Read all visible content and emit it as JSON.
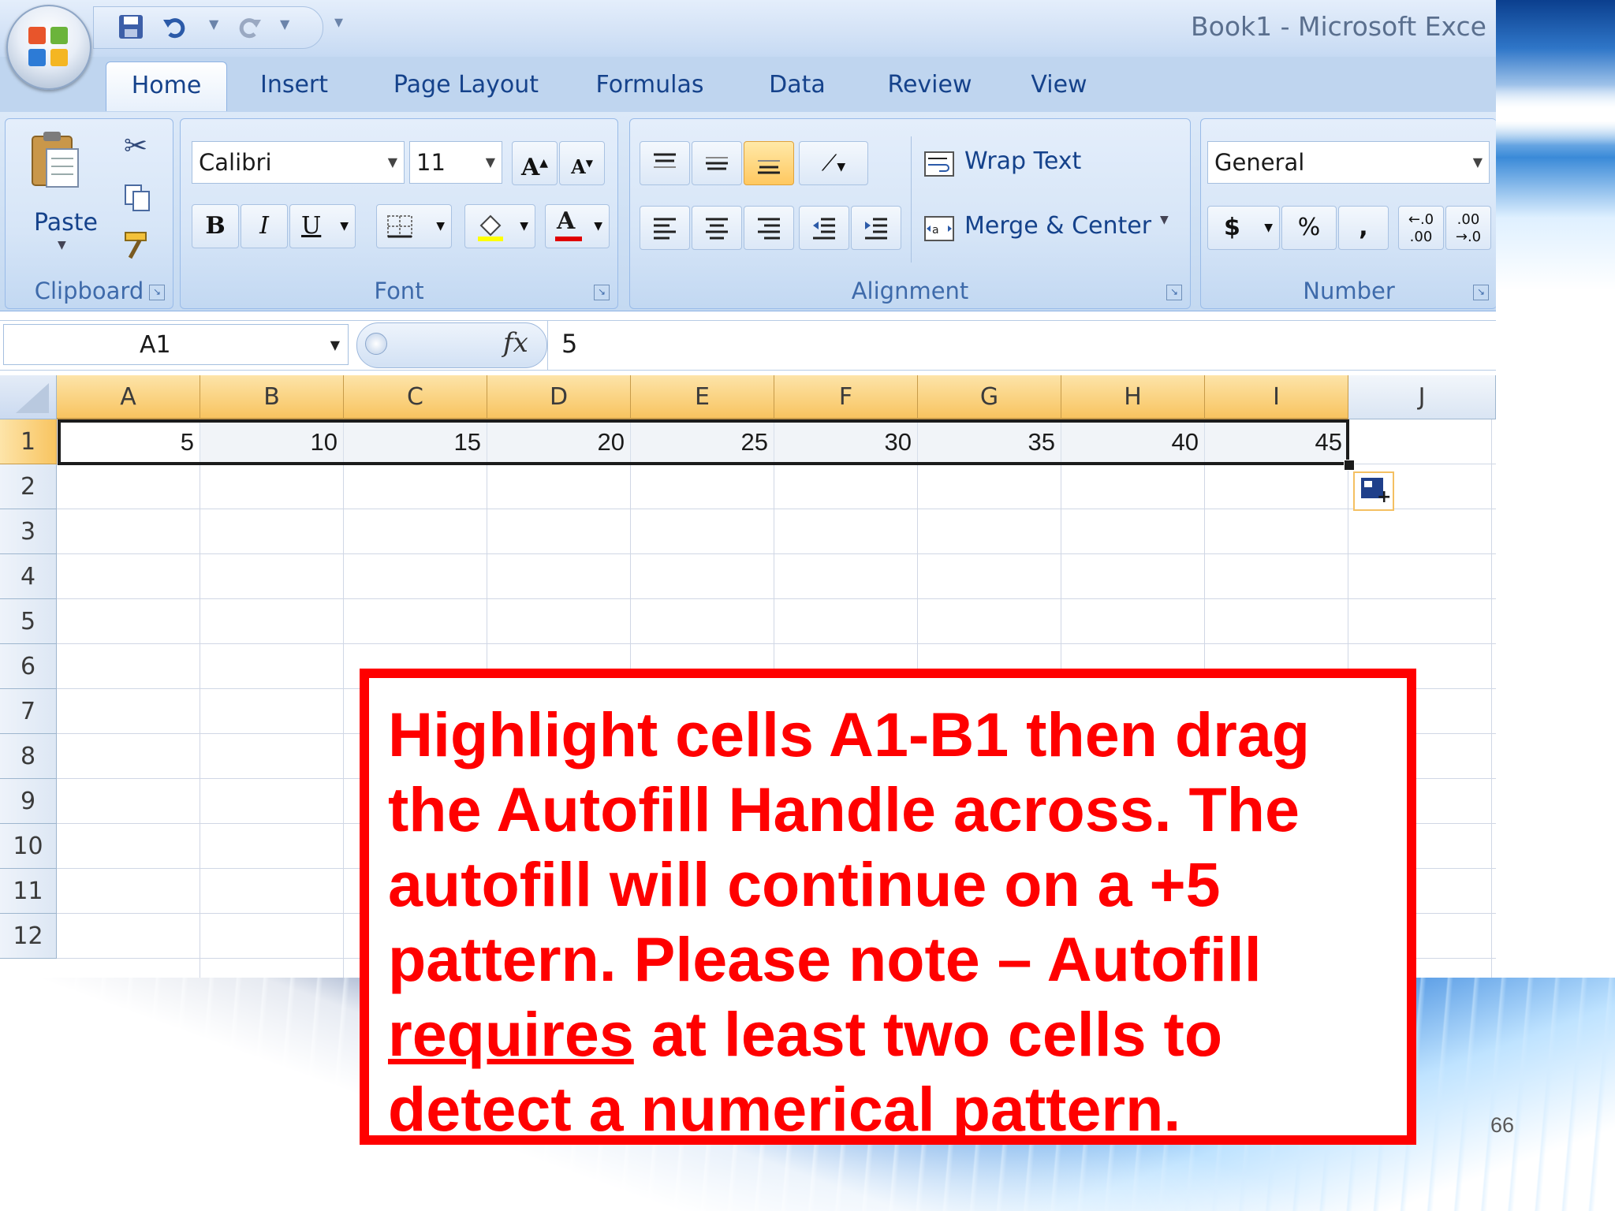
{
  "window": {
    "title": "Book1  -  Microsoft Exce"
  },
  "ribbon_tabs": [
    "Home",
    "Insert",
    "Page Layout",
    "Formulas",
    "Data",
    "Review",
    "View"
  ],
  "active_tab": "Home",
  "clipboard": {
    "paste_label": "Paste",
    "group_label": "Clipboard"
  },
  "font": {
    "name": "Calibri",
    "size": "11",
    "group_label": "Font",
    "bold": "B",
    "italic": "I",
    "underline": "U",
    "grow": "A",
    "shrink": "A",
    "color_letter": "A"
  },
  "alignment": {
    "wrap_text": "Wrap Text",
    "merge_center": "Merge & Center",
    "group_label": "Alignment"
  },
  "number": {
    "format": "General",
    "currency": "$",
    "percent": "%",
    "comma": ",",
    "group_label": "Number"
  },
  "formula_bar": {
    "name_box": "A1",
    "fx_label": "fx",
    "value": "5"
  },
  "sheet": {
    "columns": [
      "A",
      "B",
      "C",
      "D",
      "E",
      "F",
      "G",
      "H",
      "I",
      "J"
    ],
    "rows": [
      "1",
      "2",
      "3",
      "4",
      "5",
      "6",
      "7",
      "8",
      "9",
      "10",
      "11",
      "12"
    ],
    "row1_values": [
      "5",
      "10",
      "15",
      "20",
      "25",
      "30",
      "35",
      "40",
      "45"
    ]
  },
  "callout": {
    "line1": "Highlight cells A1-B1 then drag",
    "line2": "the Autofill Handle across.  The",
    "line3": "autofill will continue on a +5",
    "line4": "pattern.  Please note – Autofill",
    "line5_underlined": "requires",
    "line5_rest": " at least two cells to",
    "line6": "detect a numerical pattern."
  },
  "slide_number": "66",
  "colors": {
    "callout_red": "#ff0000",
    "selected_header": "#f8c460",
    "ribbon_blue": "#c4d9f1"
  }
}
